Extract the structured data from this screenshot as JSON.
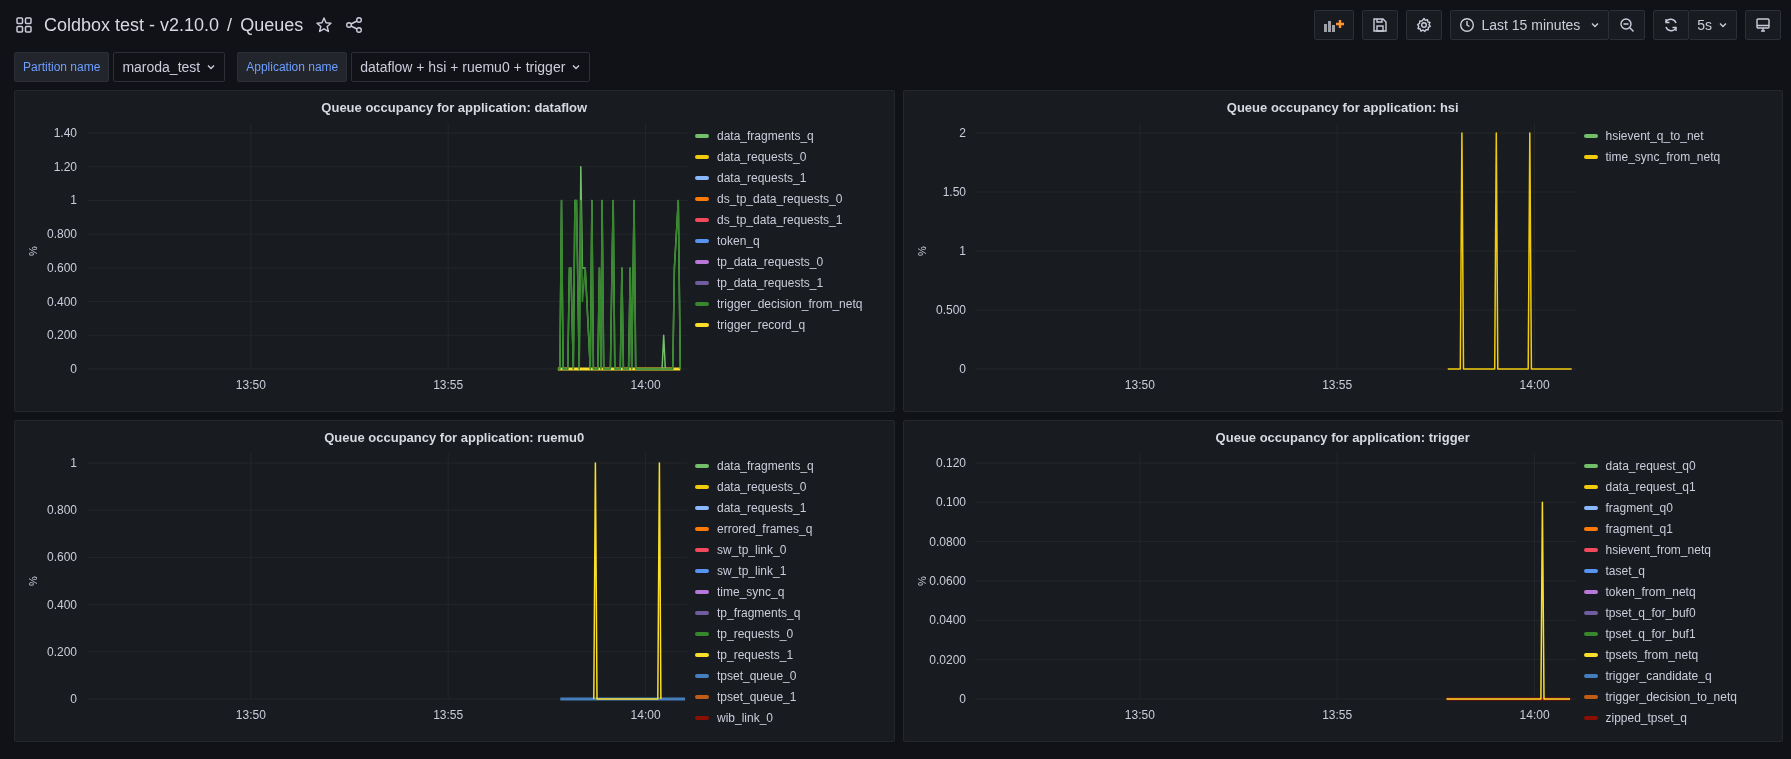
{
  "header": {
    "breadcrumb": [
      "Coldbox test - v2.10.0",
      "Queues"
    ],
    "separator": "/",
    "time_range": "Last 15 minutes",
    "refresh_interval": "5s"
  },
  "variables": [
    {
      "label": "Partition name",
      "value": "maroda_test"
    },
    {
      "label": "Application name",
      "value": "dataflow + hsi + ruemu0 + trigger"
    }
  ],
  "panels": [
    {
      "title": "Queue occupancy for application: dataflow",
      "chart_data": {
        "type": "line",
        "ylabel": "%",
        "grid": true,
        "xlim": [
          825.85,
          841.05
        ],
        "ylim": [
          0,
          1.4
        ],
        "xticks": [
          {
            "value": 830,
            "label": "13:50"
          },
          {
            "value": 835,
            "label": "13:55"
          },
          {
            "value": 840,
            "label": "14:00"
          }
        ],
        "yticks": [
          {
            "value": 0,
            "label": "0"
          },
          {
            "value": 0.2,
            "label": "0.200"
          },
          {
            "value": 0.4,
            "label": "0.400"
          },
          {
            "value": 0.6,
            "label": "0.600"
          },
          {
            "value": 0.8,
            "label": "0.800"
          },
          {
            "value": 1,
            "label": "1"
          },
          {
            "value": 1.2,
            "label": "1.20"
          },
          {
            "value": 1.4,
            "label": "1.40"
          }
        ],
        "x": [
          837.78,
          837.83,
          837.87,
          837.91,
          838.03,
          838.07,
          838.11,
          838.17,
          838.21,
          838.25,
          838.32,
          838.36,
          838.4,
          838.47,
          838.6,
          838.64,
          838.68,
          838.79,
          838.83,
          838.87,
          838.9,
          838.94,
          839.11,
          839.15,
          839.18,
          839.22,
          839.36,
          839.4,
          839.44,
          839.57,
          839.61,
          839.65,
          839.71,
          839.75,
          840.42,
          840.46,
          840.5,
          840.69,
          840.73,
          840.83,
          840.88
        ],
        "series": [
          {
            "name": "data_fragments_q",
            "color": "#73bf69",
            "values": [
              0,
              0,
              1,
              0,
              0,
              0.6,
              0.6,
              0,
              1,
              1,
              0,
              1.2,
              0.6,
              0.6,
              0,
              1,
              0,
              0,
              0.6,
              0,
              1,
              0,
              0,
              0.6,
              1,
              0,
              0,
              0.6,
              0,
              0,
              0.6,
              0,
              1,
              0,
              0,
              0.2,
              0,
              0,
              0.6,
              1,
              0
            ]
          },
          {
            "name": "data_requests_0",
            "color": "#f2cc0c",
            "values": [
              null,
              null,
              null,
              null,
              null,
              null,
              null,
              null,
              null,
              null,
              null,
              null,
              null,
              null,
              null,
              null,
              null,
              null,
              null,
              null,
              null,
              null,
              null,
              null,
              null,
              null,
              null,
              null,
              null,
              null,
              null,
              null,
              null,
              null,
              null,
              null,
              null,
              null,
              null,
              null,
              null
            ]
          },
          {
            "name": "data_requests_1",
            "color": "#8ab8ff",
            "values": [
              null,
              null,
              null,
              null,
              null,
              null,
              null,
              null,
              null,
              null,
              null,
              null,
              null,
              null,
              null,
              null,
              null,
              null,
              null,
              null,
              null,
              null,
              null,
              null,
              null,
              null,
              null,
              null,
              null,
              null,
              null,
              null,
              null,
              null,
              null,
              null,
              null,
              null,
              null,
              null,
              null
            ]
          },
          {
            "name": "ds_tp_data_requests_0",
            "color": "#ff780a",
            "values": [
              null,
              null,
              null,
              null,
              null,
              null,
              null,
              null,
              null,
              null,
              null,
              null,
              null,
              null,
              null,
              null,
              null,
              null,
              null,
              null,
              null,
              null,
              null,
              null,
              null,
              null,
              null,
              null,
              null,
              null,
              null,
              null,
              null,
              null,
              null,
              null,
              null,
              null,
              null,
              null,
              null
            ]
          },
          {
            "name": "ds_tp_data_requests_1",
            "color": "#f2495c",
            "values": [
              null,
              null,
              null,
              null,
              null,
              null,
              null,
              null,
              null,
              null,
              null,
              null,
              null,
              null,
              null,
              null,
              null,
              null,
              null,
              null,
              null,
              null,
              null,
              null,
              null,
              null,
              null,
              null,
              null,
              null,
              null,
              null,
              null,
              null,
              null,
              null,
              null,
              null,
              null,
              null,
              null
            ]
          },
          {
            "name": "token_q",
            "color": "#5794f2",
            "values": [
              null,
              null,
              null,
              null,
              null,
              null,
              null,
              null,
              null,
              null,
              null,
              null,
              null,
              null,
              null,
              null,
              null,
              null,
              null,
              null,
              null,
              null,
              null,
              null,
              null,
              null,
              null,
              null,
              null,
              null,
              null,
              null,
              null,
              null,
              null,
              null,
              null,
              null,
              null,
              null,
              null
            ]
          },
          {
            "name": "tp_data_requests_0",
            "color": "#b877d9",
            "values": [
              null,
              null,
              null,
              null,
              null,
              null,
              null,
              null,
              null,
              null,
              null,
              null,
              null,
              null,
              null,
              null,
              null,
              null,
              null,
              null,
              null,
              null,
              null,
              null,
              null,
              null,
              null,
              null,
              null,
              null,
              null,
              null,
              null,
              null,
              null,
              null,
              null,
              null,
              null,
              null,
              null
            ]
          },
          {
            "name": "tp_data_requests_1",
            "color": "#705da0",
            "values": [
              null,
              null,
              null,
              null,
              null,
              null,
              null,
              null,
              null,
              null,
              null,
              null,
              null,
              null,
              null,
              null,
              null,
              null,
              null,
              null,
              null,
              null,
              null,
              null,
              null,
              null,
              null,
              null,
              null,
              null,
              null,
              null,
              null,
              null,
              null,
              null,
              null,
              null,
              null,
              null,
              null
            ]
          },
          {
            "name": "trigger_decision_from_netq",
            "color": "#37872d",
            "values": [
              0,
              0,
              1,
              0,
              0,
              0.6,
              0.6,
              0,
              1,
              1,
              0,
              1,
              0.4,
              0.6,
              0,
              1,
              0,
              0,
              0.6,
              0,
              1,
              0,
              0,
              0.6,
              1,
              0,
              0,
              0.6,
              0,
              0,
              0.6,
              0,
              1,
              0,
              0,
              0,
              0,
              0,
              0.6,
              1,
              0
            ]
          },
          {
            "name": "trigger_record_q",
            "color": "#fade2a",
            "values": [
              0,
              0,
              0,
              0,
              0,
              0,
              0,
              0,
              0,
              0,
              0,
              0,
              0,
              0,
              0,
              0,
              0,
              0,
              0,
              0,
              0,
              0,
              0,
              0,
              0,
              0,
              0,
              0,
              0,
              0,
              0,
              0,
              0,
              0,
              0,
              0,
              0,
              0,
              0,
              0,
              0
            ]
          }
        ]
      }
    },
    {
      "title": "Queue occupancy for application: hsi",
      "chart_data": {
        "type": "line",
        "ylabel": "%",
        "grid": true,
        "xlim": [
          825.85,
          841.05
        ],
        "ylim": [
          0,
          2
        ],
        "xticks": [
          {
            "value": 830,
            "label": "13:50"
          },
          {
            "value": 835,
            "label": "13:55"
          },
          {
            "value": 840,
            "label": "14:00"
          }
        ],
        "yticks": [
          {
            "value": 0,
            "label": "0"
          },
          {
            "value": 0.5,
            "label": "0.500"
          },
          {
            "value": 1,
            "label": "1"
          },
          {
            "value": 1.5,
            "label": "1.50"
          },
          {
            "value": 2,
            "label": "2"
          }
        ],
        "x": [
          837.8,
          838.12,
          838.16,
          838.2,
          838.99,
          839.03,
          839.07,
          839.84,
          839.88,
          839.92,
          840.94
        ],
        "series": [
          {
            "name": "hsievent_q_to_net",
            "color": "#73bf69",
            "values": [
              null,
              null,
              null,
              null,
              null,
              null,
              null,
              null,
              null,
              null,
              null
            ]
          },
          {
            "name": "time_sync_from_netq",
            "color": "#f2cc0c",
            "values": [
              0,
              0,
              2,
              0,
              0,
              2,
              0,
              0,
              2,
              0,
              0
            ]
          }
        ]
      }
    },
    {
      "title": "Queue occupancy for application: ruemu0",
      "chart_data": {
        "type": "line",
        "ylabel": "%",
        "grid": true,
        "xlim": [
          825.85,
          841.05
        ],
        "ylim": [
          0,
          1
        ],
        "xticks": [
          {
            "value": 830,
            "label": "13:50"
          },
          {
            "value": 835,
            "label": "13:55"
          },
          {
            "value": 840,
            "label": "14:00"
          }
        ],
        "yticks": [
          {
            "value": 0,
            "label": "0"
          },
          {
            "value": 0.2,
            "label": "0.200"
          },
          {
            "value": 0.4,
            "label": "0.400"
          },
          {
            "value": 0.6,
            "label": "0.600"
          },
          {
            "value": 0.8,
            "label": "0.800"
          },
          {
            "value": 1,
            "label": "1"
          }
        ],
        "x": [
          837.84,
          838.69,
          838.73,
          838.77,
          840.31,
          840.35,
          840.39,
          841.0
        ],
        "series": [
          {
            "name": "data_fragments_q",
            "color": "#73bf69",
            "values": [
              null,
              null,
              null,
              null,
              null,
              null,
              null,
              null
            ]
          },
          {
            "name": "data_requests_0",
            "color": "#f2cc0c",
            "values": [
              null,
              null,
              null,
              null,
              null,
              null,
              null,
              null
            ]
          },
          {
            "name": "data_requests_1",
            "color": "#8ab8ff",
            "values": [
              null,
              null,
              null,
              null,
              null,
              null,
              null,
              null
            ]
          },
          {
            "name": "errored_frames_q",
            "color": "#ff780a",
            "values": [
              null,
              null,
              null,
              null,
              null,
              null,
              null,
              null
            ]
          },
          {
            "name": "sw_tp_link_0",
            "color": "#f2495c",
            "values": [
              null,
              null,
              null,
              null,
              null,
              null,
              null,
              null
            ]
          },
          {
            "name": "sw_tp_link_1",
            "color": "#5794f2",
            "values": [
              null,
              null,
              null,
              null,
              null,
              null,
              null,
              null
            ]
          },
          {
            "name": "time_sync_q",
            "color": "#b877d9",
            "values": [
              null,
              null,
              null,
              null,
              null,
              null,
              null,
              null
            ]
          },
          {
            "name": "tp_fragments_q",
            "color": "#705da0",
            "values": [
              null,
              null,
              null,
              null,
              null,
              null,
              null,
              null
            ]
          },
          {
            "name": "tp_requests_0",
            "color": "#37872d",
            "values": [
              null,
              null,
              null,
              null,
              null,
              null,
              null,
              null
            ]
          },
          {
            "name": "tp_requests_1",
            "color": "#fade2a",
            "values": [
              null,
              0,
              1,
              0,
              0,
              1,
              0,
              null
            ]
          },
          {
            "name": "tpset_queue_0",
            "color": "#447ebc",
            "values": [
              0,
              0,
              0,
              0,
              0,
              0,
              0,
              0
            ]
          },
          {
            "name": "tpset_queue_1",
            "color": "#c15c17",
            "values": [
              null,
              null,
              null,
              null,
              null,
              null,
              null,
              null
            ]
          },
          {
            "name": "wib_link_0",
            "color": "#890f02",
            "values": [
              null,
              null,
              null,
              null,
              null,
              null,
              null,
              null
            ]
          }
        ]
      }
    },
    {
      "title": "Queue occupancy for application: trigger",
      "chart_data": {
        "type": "line",
        "ylabel": "%",
        "grid": true,
        "xlim": [
          825.85,
          841.05
        ],
        "ylim": [
          0,
          0.12
        ],
        "xticks": [
          {
            "value": 830,
            "label": "13:50"
          },
          {
            "value": 835,
            "label": "13:55"
          },
          {
            "value": 840,
            "label": "14:00"
          }
        ],
        "yticks": [
          {
            "value": 0,
            "label": "0"
          },
          {
            "value": 0.02,
            "label": "0.0200"
          },
          {
            "value": 0.04,
            "label": "0.0400"
          },
          {
            "value": 0.06,
            "label": "0.0600"
          },
          {
            "value": 0.08,
            "label": "0.0800"
          },
          {
            "value": 0.1,
            "label": "0.100"
          },
          {
            "value": 0.12,
            "label": "0.120"
          }
        ],
        "x": [
          837.77,
          840.16,
          840.2,
          840.24,
          840.9
        ],
        "series": [
          {
            "name": "data_request_q0",
            "color": "#73bf69",
            "values": [
              null,
              null,
              null,
              null,
              null
            ]
          },
          {
            "name": "data_request_q1",
            "color": "#f2cc0c",
            "values": [
              null,
              null,
              null,
              null,
              null
            ]
          },
          {
            "name": "fragment_q0",
            "color": "#8ab8ff",
            "values": [
              null,
              null,
              null,
              null,
              null
            ]
          },
          {
            "name": "fragment_q1",
            "color": "#ff780a",
            "values": [
              null,
              null,
              null,
              null,
              null
            ]
          },
          {
            "name": "hsievent_from_netq",
            "color": "#f2495c",
            "values": [
              null,
              null,
              null,
              null,
              null
            ]
          },
          {
            "name": "taset_q",
            "color": "#5794f2",
            "values": [
              null,
              null,
              null,
              null,
              null
            ]
          },
          {
            "name": "token_from_netq",
            "color": "#b877d9",
            "values": [
              null,
              null,
              null,
              null,
              null
            ]
          },
          {
            "name": "tpset_q_for_buf0",
            "color": "#705da0",
            "values": [
              null,
              null,
              null,
              null,
              null
            ]
          },
          {
            "name": "tpset_q_for_buf1",
            "color": "#37872d",
            "values": [
              null,
              null,
              null,
              null,
              null
            ]
          },
          {
            "name": "tpsets_from_netq",
            "color": "#fade2a",
            "values": [
              0,
              0,
              0.1,
              0,
              0
            ]
          },
          {
            "name": "trigger_candidate_q",
            "color": "#447ebc",
            "values": [
              null,
              null,
              null,
              null,
              null
            ]
          },
          {
            "name": "trigger_decision_to_netq",
            "color": "#c15c17",
            "values": [
              null,
              null,
              null,
              null,
              null
            ]
          },
          {
            "name": "zipped_tpset_q",
            "color": "#890f02",
            "values": [
              0,
              0,
              0,
              0,
              0
            ]
          }
        ]
      }
    }
  ]
}
